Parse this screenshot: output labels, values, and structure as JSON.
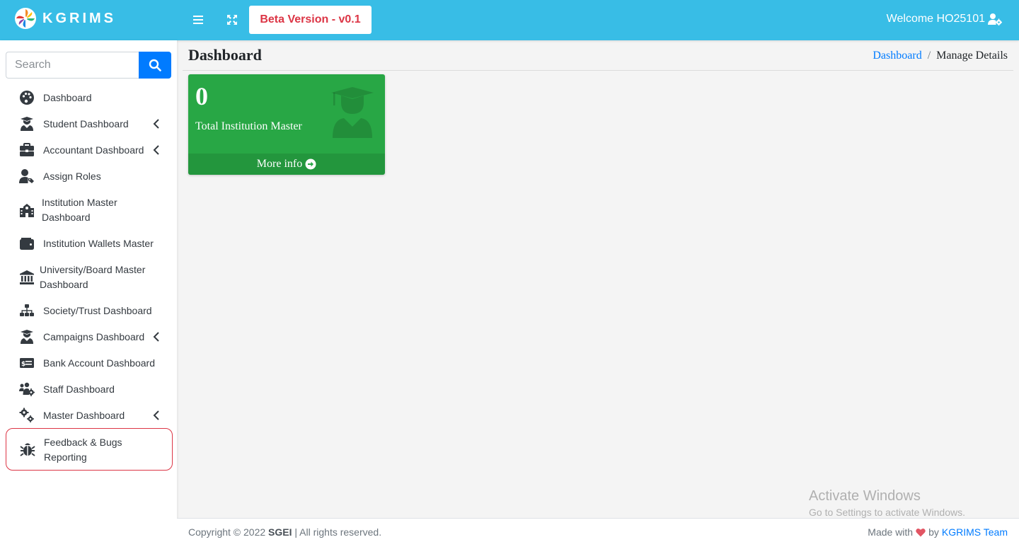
{
  "topbar": {
    "brand": "KGRIMS",
    "beta_label": "Beta Version - v0.1",
    "welcome": "Welcome HO25101",
    "logo_icon": "pinwheel-logo-icon",
    "menu_icon": "hamburger-icon",
    "fullscreen_icon": "expand-arrows-icon",
    "user_icon": "user-cog-icon",
    "color": "#38bde6"
  },
  "sidebar": {
    "search_placeholder": "Search",
    "search_icon": "search-icon",
    "items": [
      {
        "label": "Dashboard",
        "icon": "palette-icon",
        "has_submenu": false
      },
      {
        "label": "Student Dashboard",
        "icon": "graduate-icon",
        "has_submenu": true
      },
      {
        "label": "Accountant Dashboard",
        "icon": "briefcase-icon",
        "has_submenu": true
      },
      {
        "label": "Assign Roles",
        "icon": "user-tag-icon",
        "has_submenu": false
      },
      {
        "label": "Institution Master Dashboard",
        "icon": "school-icon",
        "has_submenu": false
      },
      {
        "label": "Institution Wallets Master",
        "icon": "wallet-icon",
        "has_submenu": false
      },
      {
        "label": "University/Board Master Dashboard",
        "icon": "university-icon",
        "has_submenu": false
      },
      {
        "label": "Society/Trust Dashboard",
        "icon": "sitemap-icon",
        "has_submenu": false
      },
      {
        "label": "Campaigns Dashboard",
        "icon": "graduate-icon",
        "has_submenu": true
      },
      {
        "label": "Bank Account Dashboard",
        "icon": "money-check-icon",
        "has_submenu": false
      },
      {
        "label": "Staff Dashboard",
        "icon": "users-cog-icon",
        "has_submenu": false
      },
      {
        "label": "Master Dashboard",
        "icon": "cogs-icon",
        "has_submenu": true
      },
      {
        "label": "Feedback & Bugs Reporting",
        "icon": "bug-icon",
        "has_submenu": false
      }
    ]
  },
  "content": {
    "title": "Dashboard",
    "breadcrumb": [
      "Dashboard",
      "Manage Details"
    ],
    "card": {
      "value": "0",
      "label": "Total Institution Master",
      "footer": "More info",
      "icon": "user-graduate-icon",
      "footer_icon": "arrow-circle-right-icon",
      "color": "#28a745"
    }
  },
  "watermark": {
    "title": "Activate Windows",
    "subtitle": "Go to Settings to activate Windows."
  },
  "footer": {
    "copyright_prefix": "Copyright © 2022",
    "org": "SGEI",
    "rights": "| All rights reserved.",
    "made_with": "Made with",
    "by": "by",
    "team": "KGRIMS Team",
    "heart_icon": "heart-icon",
    "heart_color": "#e25563"
  }
}
